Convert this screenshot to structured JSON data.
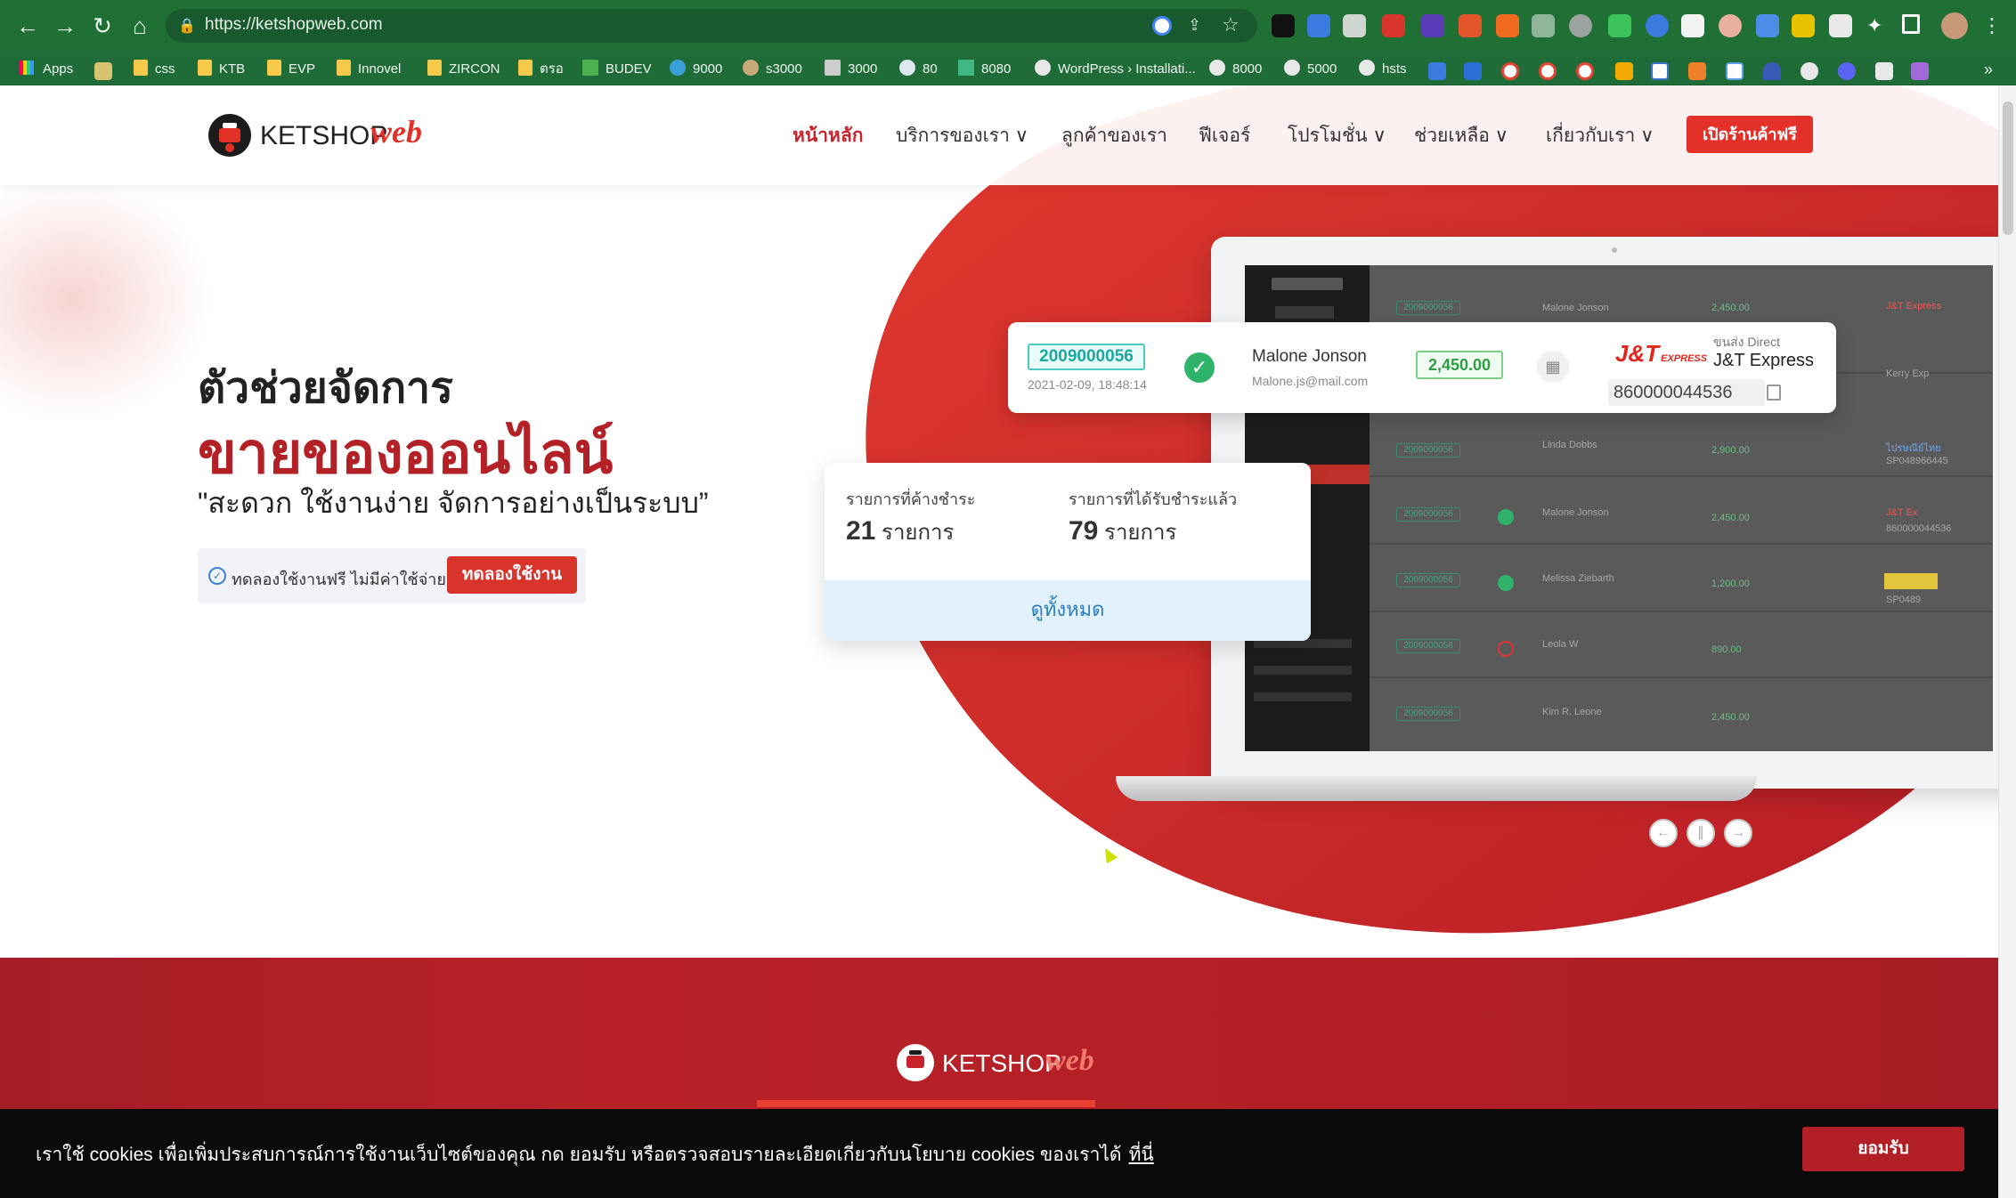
{
  "browser": {
    "url": "https://ketshopweb.com",
    "bookmarks": [
      "Apps",
      "css",
      "KTB",
      "EVP",
      "Innovel",
      "ZIRCON",
      "ตรอ",
      "BUDEV",
      "9000",
      "s3000",
      "3000",
      "80",
      "8080",
      "WordPress › Installati...",
      "8000",
      "5000",
      "hsts"
    ]
  },
  "header": {
    "logo_text": "KETSHOP",
    "logo_accent": "web",
    "nav": [
      "หน้าหลัก",
      "บริการของเรา ∨",
      "ลูกค้าของเรา",
      "ฟีเจอร์",
      "โปรโมชั่น ∨",
      "ช่วยเหลือ ∨",
      "เกี่ยวกับเรา ∨"
    ],
    "cta": "เปิดร้านค้าฟรี"
  },
  "hero": {
    "title_line1": "ตัวช่วยจัดการ",
    "title_line2": "ขายของออนไลน์",
    "slogan": "\"สะดวก ใช้งานง่าย จัดการอย่างเป็นระบบ”",
    "trial_text": "ทดลองใช้งานฟรี ไม่มีค่าใช้จ่าย",
    "trial_button": "ทดลองใช้งาน"
  },
  "order_card": {
    "order_id": "2009000056",
    "date": "2021-02-09, 18:48:14",
    "customer_name": "Malone Jonson",
    "customer_email": "Malone.js@mail.com",
    "amount": "2,450.00",
    "carrier_logo": "J&T",
    "carrier_logo_sub": "EXPRESS",
    "carrier_type": "ขนส่ง Direct",
    "carrier_name": "J&T Express",
    "tracking": "860000044536"
  },
  "summary_card": {
    "pending_label": "รายการที่ค้างชำระ",
    "pending_count": "21",
    "paid_label": "รายการที่ได้รับชำระแล้ว",
    "paid_count": "79",
    "unit": "รายการ",
    "view_all": "ดูทั้งหมด"
  },
  "laptop_screen": {
    "rows": [
      {
        "id": "2009000056",
        "name": "Malone Jonson",
        "amount": "2,450.00"
      },
      {
        "id": "2009000056",
        "name": "Linda Dobbs",
        "amount": "2,900.00"
      },
      {
        "id": "2009000056",
        "name": "Malone Jonson",
        "amount": "2,450.00"
      },
      {
        "id": "2009000056",
        "name": "Melissa Ziebarth",
        "amount": "1,200.00"
      },
      {
        "id": "2009000056",
        "name": "Leola W",
        "amount": "890.00"
      },
      {
        "id": "2009000056",
        "name": "Kim R. Leone",
        "amount": "2,450.00"
      }
    ],
    "side_carriers": [
      "J&T Express",
      "Kerry Exp",
      "ไปรษณีย์ไทย",
      "J&T Ex",
      "SP0489"
    ],
    "side_tracking": [
      "860000044536",
      "SP048966445"
    ]
  },
  "cookie": {
    "text": "เราใช้ cookies เพื่อเพิ่มประสบการณ์การใช้งานเว็บไซต์ของคุณ กด ยอมรับ หรือตรวจสอบรายละเอียดเกี่ยวกับนโยบาย cookies ของเราได้",
    "link": "ที่นี่",
    "accept": "ยอมรับ"
  },
  "colors": {
    "brand_red": "#c8232c",
    "accent_red": "#e3312a",
    "browser_green": "#207036"
  }
}
